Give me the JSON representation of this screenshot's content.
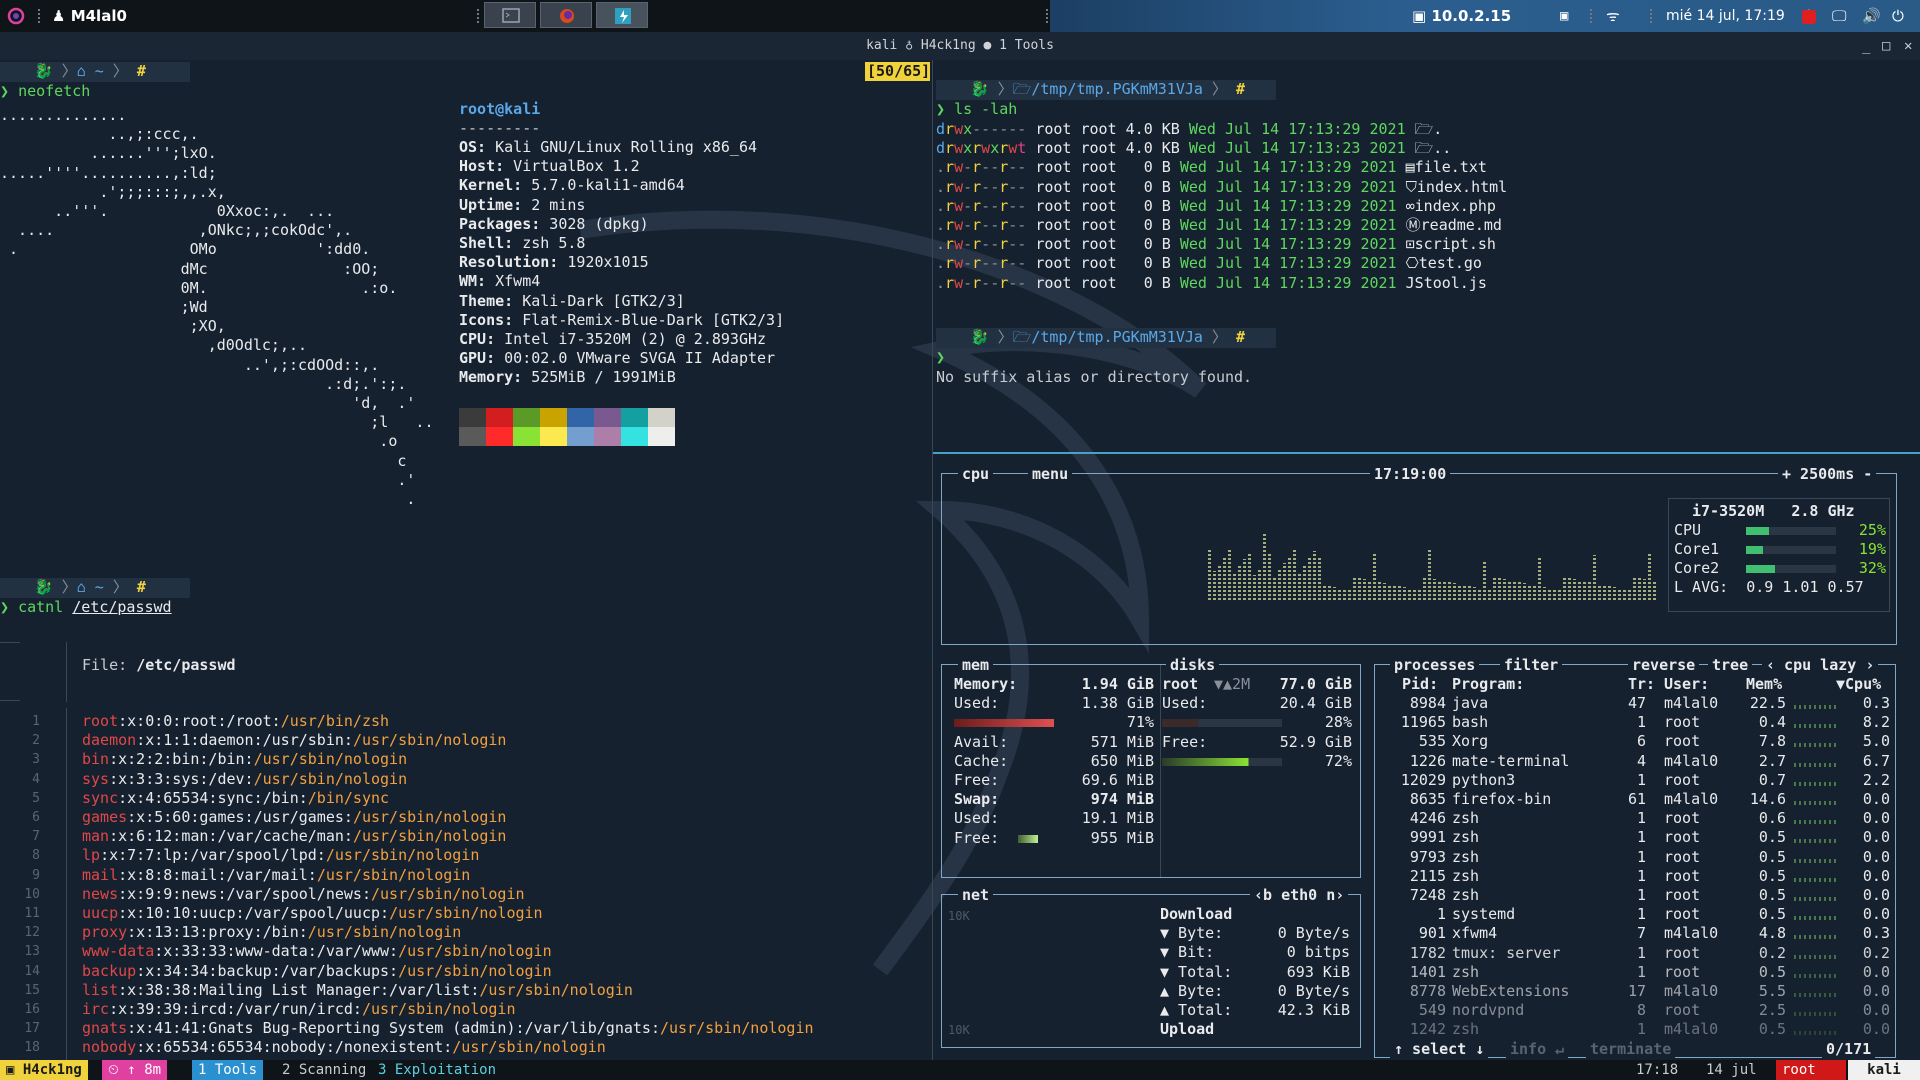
{
  "topbar": {
    "username": "M4lal0",
    "ip": "10.0.2.15",
    "datetime": "mié 14 jul, 17:19"
  },
  "window": {
    "title": "kali ♁ H4ck1ng ● 1 Tools",
    "minimize": "_",
    "maximize": "□",
    "close": "✕"
  },
  "left_pane": {
    "prompt_path": "~",
    "command1": "neofetch",
    "counter": "[50/65]",
    "neofetch_info": {
      "userhost": "root@kali",
      "sep": "---------",
      "lines": [
        {
          "k": "OS:",
          "v": " Kali GNU/Linux Rolling x86_64"
        },
        {
          "k": "Host:",
          "v": " VirtualBox 1.2"
        },
        {
          "k": "Kernel:",
          "v": " 5.7.0-kali1-amd64"
        },
        {
          "k": "Uptime:",
          "v": " 2 mins"
        },
        {
          "k": "Packages:",
          "v": " 3028 (dpkg)"
        },
        {
          "k": "Shell:",
          "v": " zsh 5.8"
        },
        {
          "k": "Resolution:",
          "v": " 1920x1015"
        },
        {
          "k": "WM:",
          "v": " Xfwm4"
        },
        {
          "k": "Theme:",
          "v": " Kali-Dark [GTK2/3]"
        },
        {
          "k": "Icons:",
          "v": " Flat-Remix-Blue-Dark [GTK2/3]"
        },
        {
          "k": "CPU:",
          "v": " Intel i7-3520M (2) @ 2.893GHz"
        },
        {
          "k": "GPU:",
          "v": " 00:02.0 VMware SVGA II Adapter"
        },
        {
          "k": "Memory:",
          "v": " 525MiB / 1991MiB"
        }
      ],
      "palette_top": [
        "#3b3b3b",
        "#d21e1e",
        "#5a9b28",
        "#c9a300",
        "#3264a8",
        "#7a5890",
        "#14a0a0",
        "#d2d2c8"
      ],
      "palette_bottom": [
        "#5a5a5a",
        "#ff2a2a",
        "#8ae234",
        "#fce94f",
        "#729fcf",
        "#ad7fa8",
        "#34e2e2",
        "#eeeeec"
      ]
    },
    "ascii_art": [
      "..............",
      "            ..,;:ccc,.",
      "          ......''';lxO.",
      ".....''''..........,:ld;",
      "           .';;;:::;,,.x,",
      "      ..'''.            0Xxoc:,.  ...",
      "  ....                ,ONkc;,;cokOdc',.",
      " .                   OMo           ':dd0.",
      "                    dMc               :OO;",
      "                    0M.                 .:o.",
      "                    ;Wd",
      "                     ;XO,",
      "                       ,d0Odlc;,..",
      "                           ..',;:cdOOd::,.",
      "                                    .:d;.':;.",
      "                                       'd,  .'",
      "                                         ;l   ..",
      "                                          .o",
      "                                            c",
      "                                            .'",
      "                                             ."
    ],
    "command2_bin": "catnl",
    "command2_arg": "/etc/passwd",
    "file_label": "File: ",
    "file_name": "/etc/passwd",
    "passwd": [
      {
        "n": "1",
        "u": "root",
        "m": ":x:0:0:root:/root:",
        "s": "/usr/bin/zsh"
      },
      {
        "n": "2",
        "u": "daemon",
        "m": ":x:1:1:daemon:/usr/sbin:",
        "s": "/usr/sbin/nologin"
      },
      {
        "n": "3",
        "u": "bin",
        "m": ":x:2:2:bin:/bin:",
        "s": "/usr/sbin/nologin"
      },
      {
        "n": "4",
        "u": "sys",
        "m": ":x:3:3:sys:/dev:",
        "s": "/usr/sbin/nologin"
      },
      {
        "n": "5",
        "u": "sync",
        "m": ":x:4:65534:sync:/bin:",
        "s": "/bin/sync"
      },
      {
        "n": "6",
        "u": "games",
        "m": ":x:5:60:games:/usr/games:",
        "s": "/usr/sbin/nologin"
      },
      {
        "n": "7",
        "u": "man",
        "m": ":x:6:12:man:/var/cache/man:",
        "s": "/usr/sbin/nologin"
      },
      {
        "n": "8",
        "u": "lp",
        "m": ":x:7:7:lp:/var/spool/lpd:",
        "s": "/usr/sbin/nologin"
      },
      {
        "n": "9",
        "u": "mail",
        "m": ":x:8:8:mail:/var/mail:",
        "s": "/usr/sbin/nologin"
      },
      {
        "n": "10",
        "u": "news",
        "m": ":x:9:9:news:/var/spool/news:",
        "s": "/usr/sbin/nologin"
      },
      {
        "n": "11",
        "u": "uucp",
        "m": ":x:10:10:uucp:/var/spool/uucp:",
        "s": "/usr/sbin/nologin"
      },
      {
        "n": "12",
        "u": "proxy",
        "m": ":x:13:13:proxy:/bin:",
        "s": "/usr/sbin/nologin"
      },
      {
        "n": "13",
        "u": "www-data",
        "m": ":x:33:33:www-data:/var/www:",
        "s": "/usr/sbin/nologin"
      },
      {
        "n": "14",
        "u": "backup",
        "m": ":x:34:34:backup:/var/backups:",
        "s": "/usr/sbin/nologin"
      },
      {
        "n": "15",
        "u": "list",
        "m": ":x:38:38:Mailing List Manager:/var/list:",
        "s": "/usr/sbin/nologin"
      },
      {
        "n": "16",
        "u": "irc",
        "m": ":x:39:39:ircd:/var/run/ircd:",
        "s": "/usr/sbin/nologin"
      },
      {
        "n": "17",
        "u": "gnats",
        "m": ":x:41:41:Gnats Bug-Reporting System (admin):/var/lib/gnats:",
        "s": "/usr/sbin/nologin"
      },
      {
        "n": "18",
        "u": "nobody",
        "m": ":x:65534:65534:nobody:/nonexistent:",
        "s": "/usr/sbin/nologin"
      }
    ]
  },
  "right_pane": {
    "tmp_path": "/tmp/tmp.PGKmM31VJa",
    "command": "ls -lah",
    "ls_rows": [
      {
        "perm": "drwx------",
        "user": "root root",
        "size": "4.0 KB",
        "date": "Wed Jul 14 17:13:29 2021",
        "icon": "🗁",
        "name": "."
      },
      {
        "perm": "drwxrwxrwt",
        "user": "root root",
        "size": "4.0 KB",
        "date": "Wed Jul 14 17:13:23 2021",
        "icon": "🗁",
        "name": ".."
      },
      {
        "perm": ".rw-r--r--",
        "user": "root root",
        "size": "  0 B",
        "date": "Wed Jul 14 17:13:29 2021",
        "icon": "▤",
        "name": "file.txt"
      },
      {
        "perm": ".rw-r--r--",
        "user": "root root",
        "size": "  0 B",
        "date": "Wed Jul 14 17:13:29 2021",
        "icon": "⛉",
        "name": "index.html"
      },
      {
        "perm": ".rw-r--r--",
        "user": "root root",
        "size": "  0 B",
        "date": "Wed Jul 14 17:13:29 2021",
        "icon": "∞",
        "name": "index.php"
      },
      {
        "perm": ".rw-r--r--",
        "user": "root root",
        "size": "  0 B",
        "date": "Wed Jul 14 17:13:29 2021",
        "icon": "Ⓜ",
        "name": "readme.md"
      },
      {
        "perm": ".rw-r--r--",
        "user": "root root",
        "size": "  0 B",
        "date": "Wed Jul 14 17:13:29 2021",
        "icon": "⊡",
        "name": "script.sh"
      },
      {
        "perm": ".rw-r--r--",
        "user": "root root",
        "size": "  0 B",
        "date": "Wed Jul 14 17:13:29 2021",
        "icon": "⎔",
        "name": "test.go"
      },
      {
        "perm": ".rw-r--r--",
        "user": "root root",
        "size": "  0 B",
        "date": "Wed Jul 14 17:13:29 2021",
        "icon": "JS",
        "name": "tool.js"
      }
    ],
    "error": "No suffix alias or directory found."
  },
  "btop": {
    "cpu_label": "cpu",
    "menu_label": "menu",
    "clock": "17:19:00",
    "interval": "+ 2500ms -",
    "cpu_model": "i7-3520M",
    "cpu_freq": "2.8 GHz",
    "cpu_rows": [
      {
        "name": "CPU",
        "pct": "25%",
        "value": 0.25
      },
      {
        "name": "Core1",
        "pct": "19%",
        "value": 0.19
      },
      {
        "name": "Core2",
        "pct": "32%",
        "value": 0.32
      }
    ],
    "load_avg": "L AVG:  0.9 1.01 0.57",
    "mem_label": "mem",
    "mem_rows": [
      {
        "k": "Memory:",
        "v": "1.94 GiB",
        "bold": true
      },
      {
        "k": "Used:",
        "v": "1.38 GiB"
      },
      {
        "k": "",
        "v": "71%"
      },
      {
        "k": "Avail:",
        "v": "571 MiB"
      },
      {
        "k": "Cache:",
        "v": "650 MiB"
      },
      {
        "k": "Free:",
        "v": "69.6 MiB"
      },
      {
        "k": "Swap:",
        "v": "974 MiB",
        "bold": true
      },
      {
        "k": "Used:",
        "v": "19.1 MiB"
      },
      {
        "k": "Free:",
        "v": "955 MiB"
      }
    ],
    "disks_label": "disks",
    "disk_rows": [
      {
        "k": "root",
        "mid": "▼▲2M",
        "v": "77.0 GiB",
        "bold": true
      },
      {
        "k": "Used:",
        "mid": "",
        "v": "20.4 GiB"
      },
      {
        "k": "",
        "mid": "",
        "v": "28%"
      },
      {
        "k": "Free:",
        "mid": "",
        "v": "52.9 GiB"
      },
      {
        "k": "",
        "mid": "",
        "v": "72%"
      }
    ],
    "net_label": "net",
    "net_iface": "‹b eth0 n›",
    "net_scale_top": "10K",
    "net_scale_bottom": "10K",
    "net_rows": [
      {
        "k": "Download",
        "v": "",
        "bold": true
      },
      {
        "k": "▼ Byte:",
        "v": "0 Byte/s"
      },
      {
        "k": "▼ Bit:",
        "v": "0 bitps"
      },
      {
        "k": "▼ Total:",
        "v": "693 KiB"
      },
      {
        "k": "▲ Byte:",
        "v": "0 Byte/s"
      },
      {
        "k": "▲ Total:",
        "v": "42.3 KiB"
      },
      {
        "k": "Upload",
        "v": "",
        "bold": true
      }
    ],
    "proc_header_labels": {
      "processes": "processes",
      "filter": "filter",
      "reverse": "reverse",
      "tree": "tree",
      "sort": "‹ cpu lazy ›"
    },
    "proc_cols": {
      "pid": "Pid:",
      "prog": "Program:",
      "tr": "Tr:",
      "user": "User:",
      "mem": "Mem%",
      "cpu": "▼Cpu%"
    },
    "procs": [
      {
        "pid": "8984",
        "prog": "java",
        "tr": "47",
        "user": "m4lal0",
        "mem": "22.5",
        "cpu": "0.3"
      },
      {
        "pid": "11965",
        "prog": "bash",
        "tr": "1",
        "user": "root",
        "mem": "0.4",
        "cpu": "8.2"
      },
      {
        "pid": "535",
        "prog": "Xorg",
        "tr": "6",
        "user": "root",
        "mem": "7.8",
        "cpu": "5.0"
      },
      {
        "pid": "1226",
        "prog": "mate-terminal",
        "tr": "4",
        "user": "m4lal0",
        "mem": "2.7",
        "cpu": "6.7"
      },
      {
        "pid": "12029",
        "prog": "python3",
        "tr": "1",
        "user": "root",
        "mem": "0.7",
        "cpu": "2.2"
      },
      {
        "pid": "8635",
        "prog": "firefox-bin",
        "tr": "61",
        "user": "m4lal0",
        "mem": "14.6",
        "cpu": "0.0"
      },
      {
        "pid": "4246",
        "prog": "zsh",
        "tr": "1",
        "user": "root",
        "mem": "0.6",
        "cpu": "0.0"
      },
      {
        "pid": "9991",
        "prog": "zsh",
        "tr": "1",
        "user": "root",
        "mem": "0.5",
        "cpu": "0.0"
      },
      {
        "pid": "9793",
        "prog": "zsh",
        "tr": "1",
        "user": "root",
        "mem": "0.5",
        "cpu": "0.0"
      },
      {
        "pid": "2115",
        "prog": "zsh",
        "tr": "1",
        "user": "root",
        "mem": "0.5",
        "cpu": "0.0"
      },
      {
        "pid": "7248",
        "prog": "zsh",
        "tr": "1",
        "user": "root",
        "mem": "0.5",
        "cpu": "0.0"
      },
      {
        "pid": "1",
        "prog": "systemd",
        "tr": "1",
        "user": "root",
        "mem": "0.5",
        "cpu": "0.0"
      },
      {
        "pid": "901",
        "prog": "xfwm4",
        "tr": "7",
        "user": "m4lal0",
        "mem": "4.8",
        "cpu": "0.3"
      },
      {
        "pid": "1782",
        "prog": "tmux: server",
        "tr": "1",
        "user": "root",
        "mem": "0.2",
        "cpu": "0.2"
      },
      {
        "pid": "1401",
        "prog": "zsh",
        "tr": "1",
        "user": "root",
        "mem": "0.5",
        "cpu": "0.0"
      },
      {
        "pid": "8778",
        "prog": "WebExtensions",
        "tr": "17",
        "user": "m4lal0",
        "mem": "5.5",
        "cpu": "0.0"
      },
      {
        "pid": "549",
        "prog": "nordvpnd",
        "tr": "8",
        "user": "root",
        "mem": "2.5",
        "cpu": "0.0"
      },
      {
        "pid": "1242",
        "prog": "zsh",
        "tr": "1",
        "user": "m4lal0",
        "mem": "0.5",
        "cpu": "0.0"
      }
    ],
    "proc_footer": {
      "select": "↑ select ↓",
      "info": "info ↵",
      "terminate": "terminate",
      "count": "0/171"
    }
  },
  "statusbar": {
    "session": "H4ck1ng",
    "uptime": "⏲ ↑ 8m",
    "win1": "1 Tools",
    "win2": "2 Scanning",
    "win3": "3 Exploitation",
    "time": "17:18",
    "date": "14 jul",
    "user": "root",
    "host": "kali"
  }
}
